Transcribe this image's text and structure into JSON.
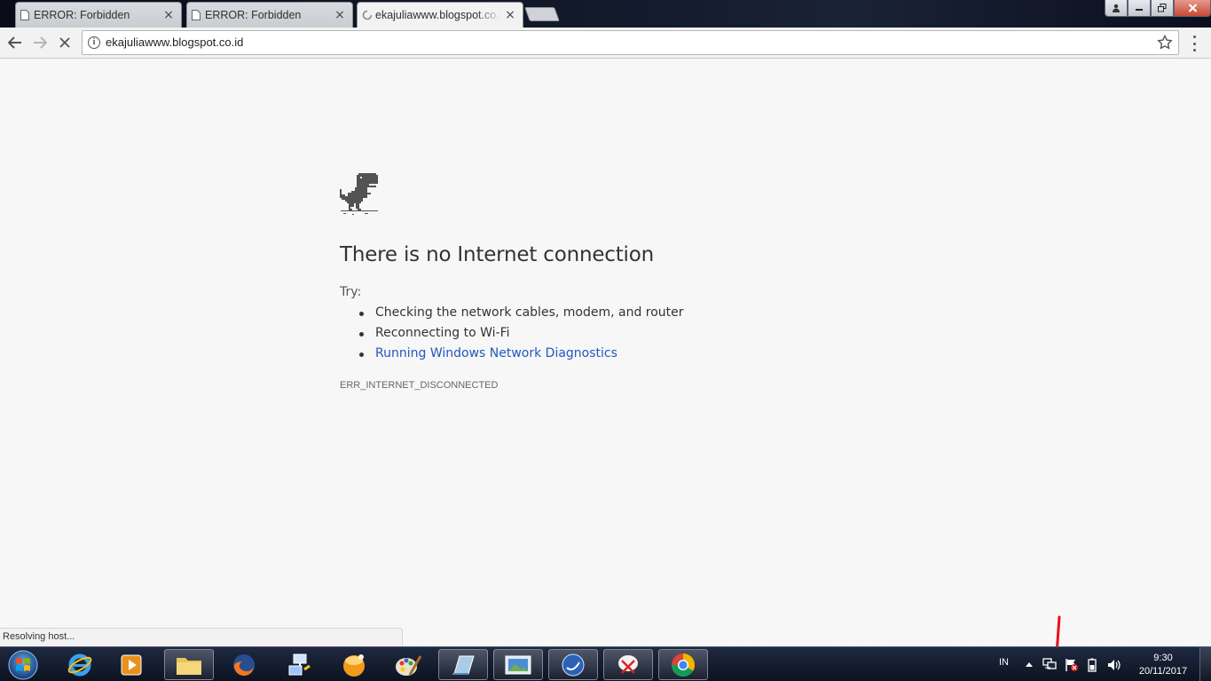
{
  "browser": {
    "tabs": [
      {
        "title": "ERROR: Forbidden",
        "active": false
      },
      {
        "title": "ERROR: Forbidden",
        "active": false
      },
      {
        "title": "ekajuliawww.blogspot.co.id",
        "active": true,
        "loading": true
      }
    ],
    "close_glyph": "×",
    "url": "ekajuliawww.blogspot.co.id",
    "status_text": "Resolving host..."
  },
  "page": {
    "heading": "There is no Internet connection",
    "try_label": "Try:",
    "suggestions": [
      "Checking the network cables, modem, and router",
      "Reconnecting to Wi-Fi",
      "Running Windows Network Diagnostics"
    ],
    "error_code": "ERR_INTERNET_DISCONNECTED"
  },
  "taskbar": {
    "apps": [
      "internet-explorer-icon",
      "media-player-icon",
      "file-explorer-icon",
      "firefox-icon",
      "network-app-icon",
      "orange-app-icon",
      "paint-icon",
      "book-app-icon",
      "photo-viewer-icon",
      "blue-globe-icon",
      "snipping-tool-icon",
      "chrome-icon"
    ],
    "language": "IN",
    "time": "9:30",
    "date": "20/11/2017"
  },
  "colors": {
    "link": "#2158bf",
    "annotation_arrow": "#e8101c",
    "taskbar": "#0c1220"
  }
}
